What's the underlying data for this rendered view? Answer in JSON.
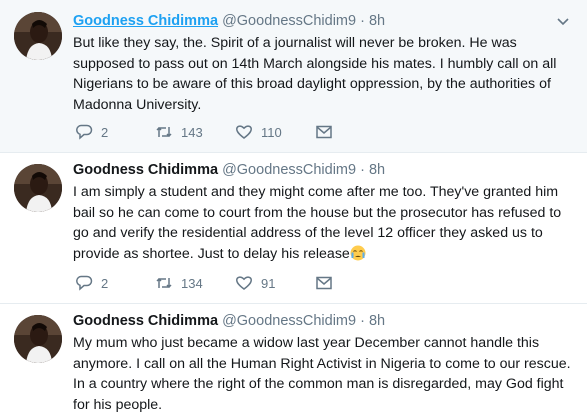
{
  "tweets": [
    {
      "name": "Goodness Chidimma",
      "handle": "@GoodnessChidim9",
      "separator": "·",
      "time": "8h",
      "text": "But like they say, the. Spirit of a journalist will never be broken. He was supposed to pass out on 14th March alongside his mates. I humbly call on all Nigerians to be aware of this broad daylight oppression, by the authorities of Madonna University.",
      "replies": "2",
      "retweets": "143",
      "likes": "110"
    },
    {
      "name": "Goodness Chidimma",
      "handle": "@GoodnessChidim9",
      "separator": "·",
      "time": "8h",
      "text": "I am simply a student and they might come after me too. They've granted him bail so he can come to court from the house but the prosecutor has refused to go and verify the residential address of the level 12 officer they asked us to provide as shortee. Just to delay his release",
      "emoji": "crying-face",
      "replies": "2",
      "retweets": "134",
      "likes": "91"
    },
    {
      "name": "Goodness Chidimma",
      "handle": "@GoodnessChidim9",
      "separator": "·",
      "time": "8h",
      "text": "My mum who just became a widow last year December cannot handle this anymore. I call on all the Human Right Activist in Nigeria to come to our rescue. In a country where the right of the common man is disregarded, may God fight for his people."
    }
  ],
  "icons": [
    "chevron-down-icon",
    "reply-icon",
    "retweet-icon",
    "heart-icon",
    "envelope-icon"
  ],
  "colors": {
    "link": "#1da1f2",
    "muted": "#657786",
    "text": "#14171a",
    "hover_bg": "#f5f8fa",
    "border": "#e6ecf0"
  }
}
